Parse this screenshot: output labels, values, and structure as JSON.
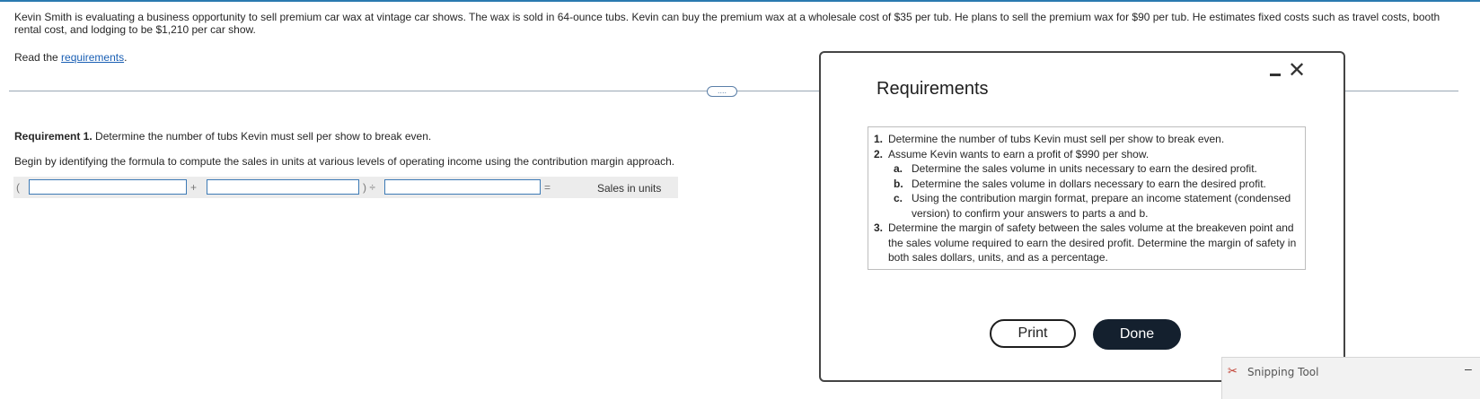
{
  "problem": {
    "text": "Kevin Smith is evaluating a business opportunity to sell premium car wax at vintage car shows. The wax is sold in 64-ounce tubs. Kevin can buy the premium wax at a wholesale cost of $35 per tub. He plans to sell the premium wax for $90 per tub. He estimates fixed costs such as travel costs, booth rental cost, and lodging to be $1,210 per car show.",
    "read_prefix": "Read the ",
    "read_link": "requirements",
    "read_suffix": "."
  },
  "more_button": "....",
  "requirement1": {
    "label": "Requirement 1.",
    "text": " Determine the number of tubs Kevin must sell per show to break even.",
    "instruction": "Begin by identifying the formula to compute the sales in units at various levels of operating income using the contribution margin approach."
  },
  "formula": {
    "open_paren": "(",
    "plus": "+",
    "close_div": ") ÷",
    "equals": "=",
    "result_label": "Sales in units",
    "field1_value": "",
    "field2_value": "",
    "field3_value": ""
  },
  "modal": {
    "title": "Requirements",
    "items": [
      {
        "num": "1.",
        "text": "Determine the number of tubs Kevin must sell per show to break even."
      },
      {
        "num": "2.",
        "text": "Assume Kevin wants to earn a profit of $990 per show."
      },
      {
        "num": "3.",
        "text": "Determine the margin of safety between the sales volume at the breakeven point and the sales volume required to earn the desired profit. Determine the margin of safety in both sales dollars, units, and as a percentage."
      }
    ],
    "subitems": [
      {
        "letter": "a.",
        "text": "Determine the sales volume in units necessary to earn the desired profit."
      },
      {
        "letter": "b.",
        "text": "Determine the sales volume in dollars necessary to earn the desired profit."
      },
      {
        "letter": "c.",
        "text": "Using the contribution margin format, prepare an income statement (condensed version) to confirm your answers to parts a and b."
      }
    ],
    "print_label": "Print",
    "done_label": "Done",
    "close_glyph": "✕"
  },
  "snipping_tool": {
    "label": "Snipping Tool",
    "icon": "✂"
  }
}
